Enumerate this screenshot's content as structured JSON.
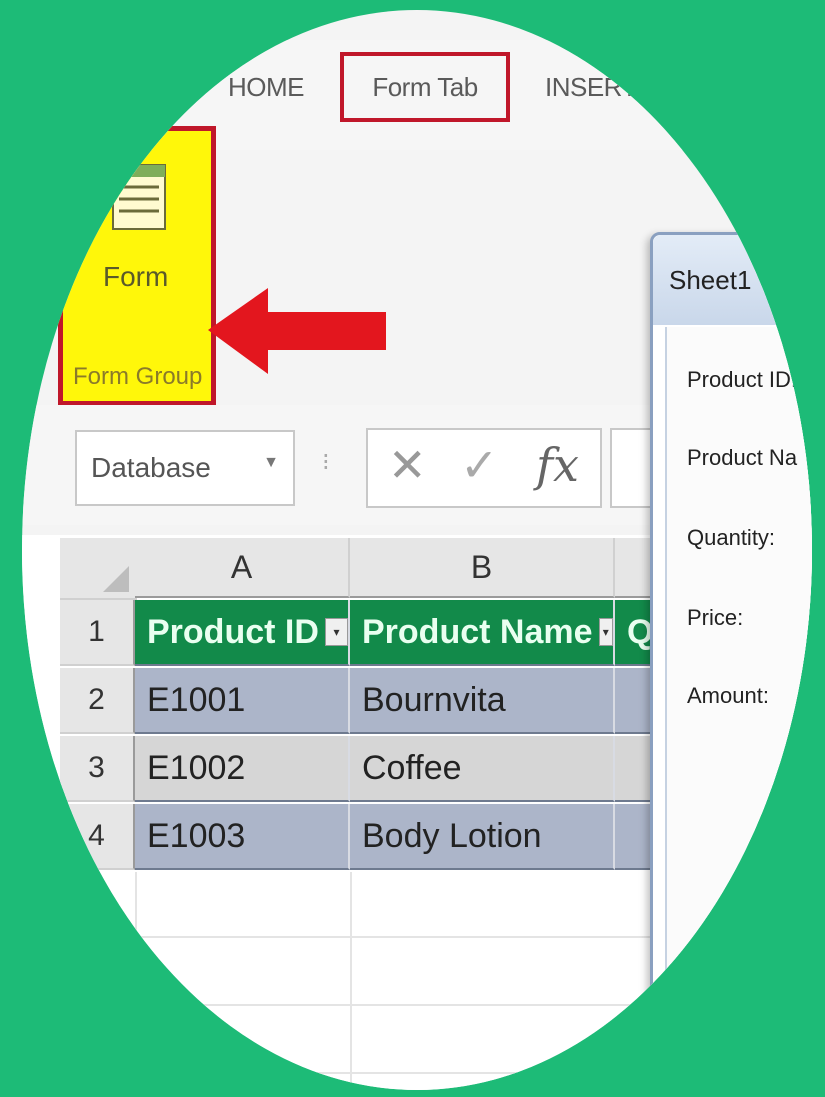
{
  "ribbon": {
    "tabs": [
      "HOME",
      "Form Tab",
      "INSERT"
    ],
    "form_button_label": "Form",
    "group_label": "Form Group"
  },
  "formula_bar": {
    "name_box_value": "Database",
    "name_box_caret": "▼",
    "separator": "⁝",
    "cancel_symbol": "✕",
    "enter_symbol": "✓",
    "function_symbol": "fx"
  },
  "spreadsheet": {
    "column_headers": [
      "A",
      "B"
    ],
    "row_numbers": [
      "1",
      "2",
      "3",
      "4"
    ],
    "header_row": [
      "Product ID",
      "Product Name",
      "Q"
    ],
    "rows": [
      [
        "E1001",
        "Bournvita"
      ],
      [
        "E1002",
        "Coffee"
      ],
      [
        "E1003",
        "Body Lotion"
      ]
    ],
    "filter_symbol": "▾"
  },
  "form_dialog": {
    "title": "Sheet1",
    "fields": [
      "Product ID:",
      "Product Na",
      "Quantity:",
      "Price:",
      "Amount:"
    ]
  },
  "colors": {
    "background": "#1dbb77",
    "highlight": "#fff70a",
    "callout_border": "#c0172a",
    "arrow": "#e3161e",
    "table_header": "#128a4a"
  }
}
